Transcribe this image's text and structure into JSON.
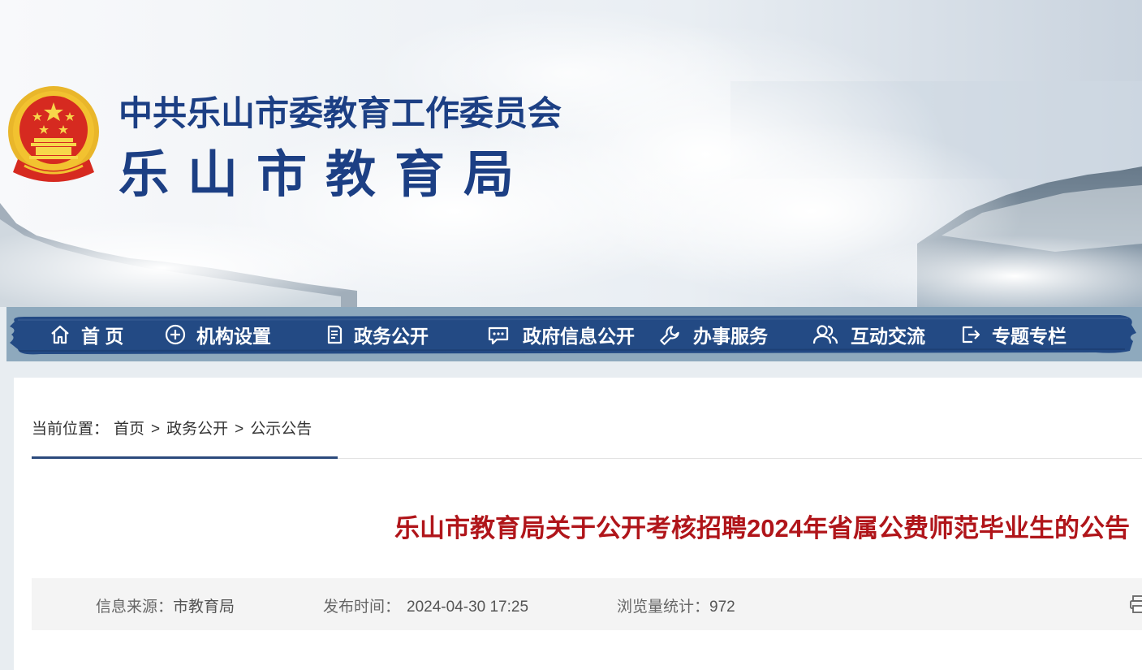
{
  "header": {
    "line1": "中共乐山市委教育工作委员会",
    "line2": "乐山市教育局"
  },
  "nav": {
    "items": [
      {
        "label": "首 页",
        "icon": "home-icon"
      },
      {
        "label": "机构设置",
        "icon": "plus-circle-icon"
      },
      {
        "label": "政务公开",
        "icon": "document-icon"
      },
      {
        "label": "政府信息公开",
        "icon": "message-icon"
      },
      {
        "label": "办事服务",
        "icon": "wrench-icon"
      },
      {
        "label": "互动交流",
        "icon": "users-icon"
      },
      {
        "label": "专题专栏",
        "icon": "exit-icon"
      }
    ]
  },
  "breadcrumb": {
    "prefix": "当前位置：",
    "items": [
      "首页",
      "政务公开",
      "公示公告"
    ],
    "separator": ">"
  },
  "article": {
    "title": "乐山市教育局关于公开考核招聘2024年省属公费师范毕业生的公告",
    "source_label": "信息来源：",
    "source_value": "市教育局",
    "time_label": "发布时间：",
    "time_value": "2024-04-30 17:25",
    "views_label": "浏览量统计：",
    "views_value": "972"
  },
  "colors": {
    "brand_blue": "#1c3f84",
    "nav_blue": "#234a84",
    "title_red": "#b0151a",
    "emblem_red": "#d62a20",
    "emblem_gold": "#f2c230"
  }
}
